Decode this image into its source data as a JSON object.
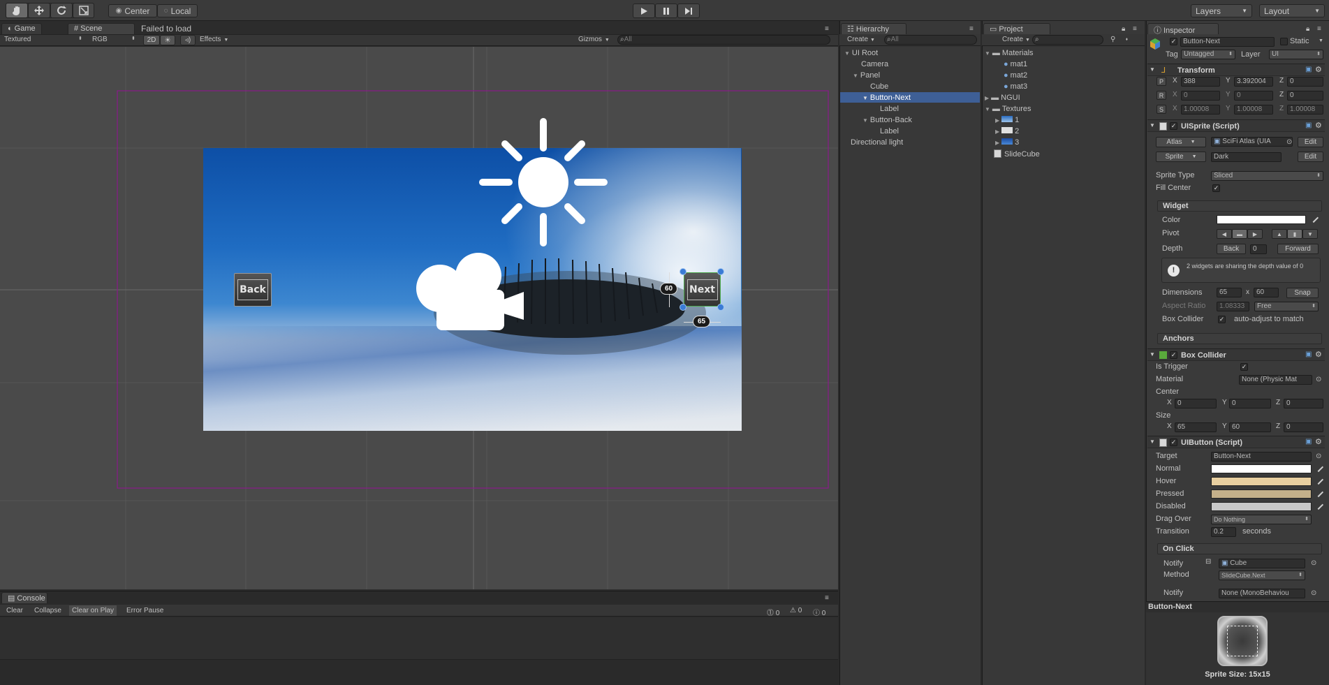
{
  "toolbar": {
    "pivot_center": "Center",
    "pivot_local": "Local",
    "layers": "Layers",
    "layout": "Layout"
  },
  "scene_tabs": {
    "game": "Game",
    "scene": "Scene",
    "status": "Failed to load"
  },
  "scene_toolbar": {
    "shading": "Textured",
    "render_mode": "RGB",
    "mode_2d": "2D",
    "effects": "Effects",
    "gizmos": "Gizmos",
    "search": "All"
  },
  "scene_view": {
    "back_label": "Back",
    "next_label": "Next",
    "height_value": "60",
    "width_value": "65"
  },
  "hierarchy": {
    "title": "Hierarchy",
    "create": "Create",
    "search": "All",
    "items": [
      "UI Root",
      "Camera",
      "Panel",
      "Cube",
      "Button-Next",
      "Label",
      "Button-Back",
      "Label",
      "Directional light"
    ]
  },
  "project": {
    "title": "Project",
    "create": "Create",
    "items": [
      "Materials",
      "mat1",
      "mat2",
      "mat3",
      "NGUI",
      "Textures",
      "1",
      "2",
      "3",
      "SlideCube"
    ]
  },
  "inspector": {
    "title": "Inspector",
    "object_name": "Button-Next",
    "static_label": "Static",
    "tag_label": "Tag",
    "tag_value": "Untagged",
    "layer_label": "Layer",
    "layer_value": "UI",
    "transform": {
      "title": "Transform",
      "p": "P",
      "r": "R",
      "s": "S",
      "x": "X",
      "y": "Y",
      "z": "Z",
      "pos": [
        "388",
        "3.392004",
        "0"
      ],
      "rot": [
        "0",
        "0",
        "0"
      ],
      "scale": [
        "1.00008",
        "1.00008",
        "1.00008"
      ]
    },
    "uisprite": {
      "title": "UISprite (Script)",
      "atlas_btn": "Atlas",
      "atlas_value": "SciFi Atlas (UIA",
      "edit": "Edit",
      "sprite_btn": "Sprite",
      "sprite_value": "Dark",
      "sprite_type_label": "Sprite Type",
      "sprite_type_value": "Sliced",
      "fill_center_label": "Fill Center",
      "widget": "Widget",
      "color_label": "Color",
      "pivot_label": "Pivot",
      "depth_label": "Depth",
      "depth_back": "Back",
      "depth_value": "0",
      "depth_forward": "Forward",
      "depth_note": "2 widgets are sharing the depth value of 0",
      "dimensions_label": "Dimensions",
      "dim_w": "65",
      "dim_x": "x",
      "dim_h": "60",
      "snap": "Snap",
      "aspect_label": "Aspect Ratio",
      "aspect_value": "1.08333",
      "aspect_mode": "Free",
      "box_collider_label": "Box Collider",
      "auto_adjust": "auto-adjust to match",
      "anchors": "Anchors"
    },
    "box_collider": {
      "title": "Box Collider",
      "is_trigger": "Is Trigger",
      "material_label": "Material",
      "material_value": "None (Physic Mat",
      "center_label": "Center",
      "center": [
        "0",
        "0",
        "0"
      ],
      "size_label": "Size",
      "size": [
        "65",
        "60",
        "0"
      ]
    },
    "uibutton": {
      "title": "UIButton (Script)",
      "target_label": "Target",
      "target_value": "Button-Next",
      "normal": "Normal",
      "hover": "Hover",
      "pressed": "Pressed",
      "disabled": "Disabled",
      "drag_over_label": "Drag Over",
      "drag_over_value": "Do Nothing",
      "transition_label": "Transition",
      "transition_value": "0.2",
      "seconds": "seconds",
      "on_click": "On Click",
      "notify_label": "Notify",
      "notify_value": "Cube",
      "method_label": "Method",
      "method_value": "SlideCube.Next",
      "notify2_value": "None (MonoBehaviou"
    },
    "colors": {
      "color": "#ffffff",
      "normal": "#ffffff",
      "hover": "#e8cfa0",
      "pressed": "#c4b08a",
      "disabled": "#c8c8c8"
    },
    "preview_title": "Button-Next",
    "preview_caption": "Sprite Size: 15x15"
  },
  "console": {
    "title": "Console",
    "clear": "Clear",
    "collapse": "Collapse",
    "clear_on_play": "Clear on Play",
    "error_pause": "Error Pause",
    "counts": [
      "0",
      "0",
      "0"
    ]
  }
}
